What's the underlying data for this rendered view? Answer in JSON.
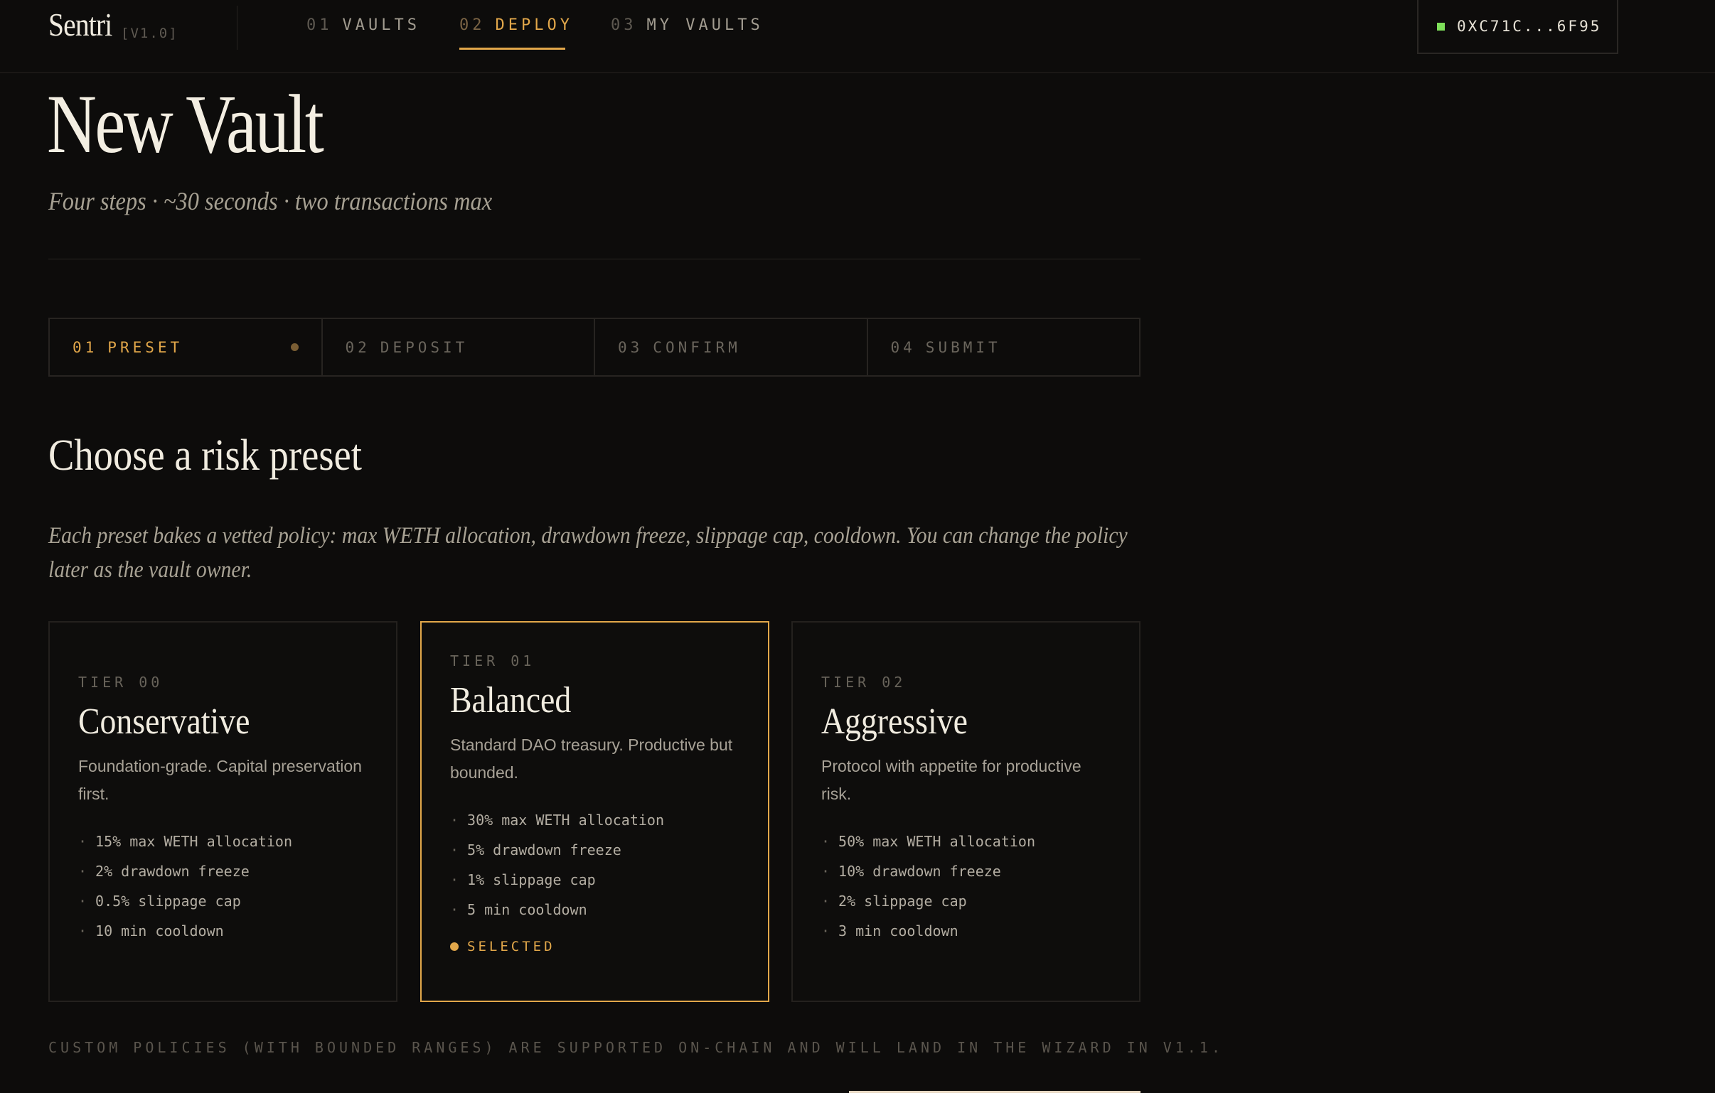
{
  "colors": {
    "background": "#0d0c0b",
    "accent": "#e2a74a",
    "wallet_status": "#7ee05a",
    "text_primary": "#f1ece0",
    "text_muted": "#a7a196"
  },
  "header": {
    "brand": "Sentri",
    "version": "[V1.0]",
    "nav": [
      {
        "num": "01",
        "label": "VAULTS"
      },
      {
        "num": "02",
        "label": "DEPLOY"
      },
      {
        "num": "03",
        "label": "MY VAULTS"
      }
    ],
    "active_nav": "DEPLOY",
    "wallet": {
      "address": "0XC71C...6F95",
      "status_icon": "connected-dot-icon"
    }
  },
  "hero": {
    "title": "New Vault",
    "subtitle": "Four steps · ~30 seconds · two transactions max"
  },
  "stepper": {
    "steps": [
      {
        "num": "01",
        "label": "PRESET"
      },
      {
        "num": "02",
        "label": "DEPOSIT"
      },
      {
        "num": "03",
        "label": "CONFIRM"
      },
      {
        "num": "04",
        "label": "SUBMIT"
      }
    ],
    "active_step": "PRESET"
  },
  "section": {
    "title": "Choose a risk preset",
    "description": "Each preset bakes a vetted policy: max WETH allocation, drawdown freeze, slippage cap, cooldown. You can change the policy later as the vault owner."
  },
  "presets": [
    {
      "tier": "TIER 00",
      "name": "Conservative",
      "description": "Foundation-grade. Capital preservation first.",
      "features": [
        "15% max WETH allocation",
        "2% drawdown freeze",
        "0.5% slippage cap",
        "10 min cooldown"
      ]
    },
    {
      "tier": "TIER 01",
      "name": "Balanced",
      "description": "Standard DAO treasury. Productive but bounded.",
      "features": [
        "30% max WETH allocation",
        "5% drawdown freeze",
        "1% slippage cap",
        "5 min cooldown"
      ],
      "badge": "SELECTED"
    },
    {
      "tier": "TIER 02",
      "name": "Aggressive",
      "description": "Protocol with appetite for productive risk.",
      "features": [
        "50% max WETH allocation",
        "10% drawdown freeze",
        "2% slippage cap",
        "3 min cooldown"
      ]
    }
  ],
  "selected_preset": "Balanced",
  "footnote": "CUSTOM POLICIES (WITH BOUNDED RANGES) ARE SUPPORTED ON-CHAIN AND WILL LAND IN THE WIZARD IN V1.1."
}
